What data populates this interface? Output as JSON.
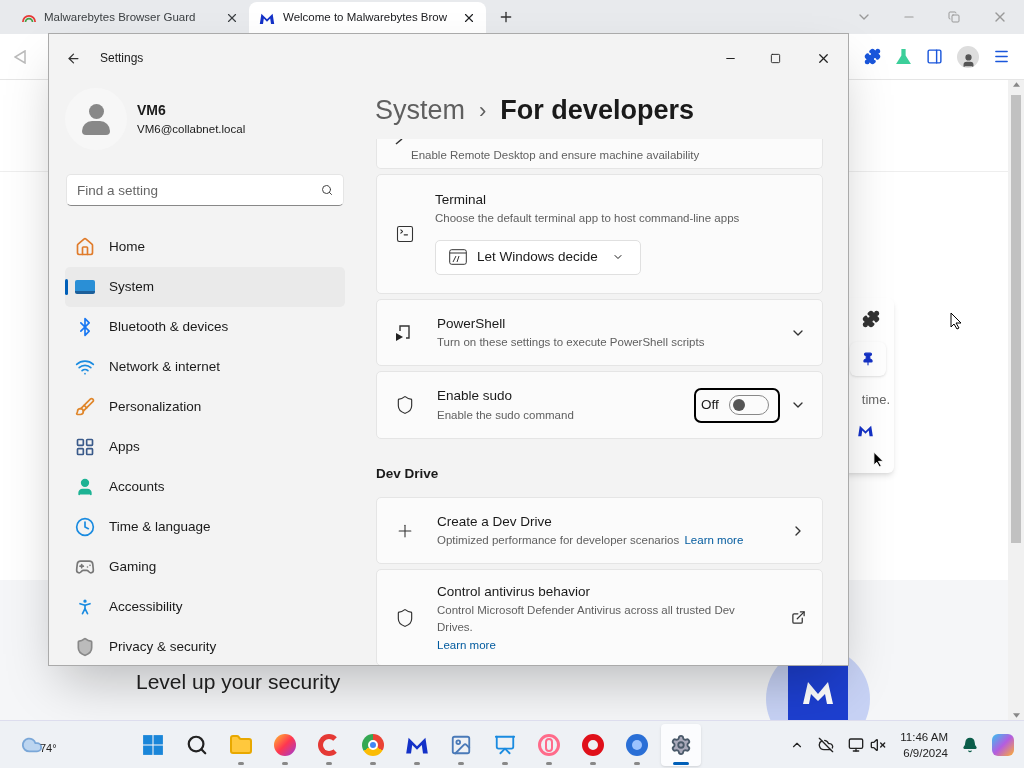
{
  "browser": {
    "tabs": [
      {
        "title": "Malwarebytes Browser Guard",
        "selected": false
      },
      {
        "title": "Welcome to Malwarebytes Brow",
        "selected": true
      }
    ],
    "page": {
      "popup_text": "time.",
      "heading": "Level up your security"
    }
  },
  "settings": {
    "title": "Settings",
    "user": {
      "name": "VM6",
      "email": "VM6@collabnet.local"
    },
    "search": {
      "placeholder": "Find a setting"
    },
    "nav": [
      {
        "label": "Home",
        "selected": false
      },
      {
        "label": "System",
        "selected": true
      },
      {
        "label": "Bluetooth & devices",
        "selected": false
      },
      {
        "label": "Network & internet",
        "selected": false
      },
      {
        "label": "Personalization",
        "selected": false
      },
      {
        "label": "Apps",
        "selected": false
      },
      {
        "label": "Accounts",
        "selected": false
      },
      {
        "label": "Time & language",
        "selected": false
      },
      {
        "label": "Gaming",
        "selected": false
      },
      {
        "label": "Accessibility",
        "selected": false
      },
      {
        "label": "Privacy & security",
        "selected": false
      }
    ],
    "breadcrumb": {
      "parent": "System",
      "separator": "›",
      "current": "For developers"
    },
    "content": [
      {
        "kind": "cut",
        "description": "Enable Remote Desktop and ensure machine availability"
      },
      {
        "kind": "dropdown",
        "title": "Terminal",
        "description": "Choose the default terminal app to host command-line apps",
        "value": "Let Windows decide"
      },
      {
        "kind": "expander",
        "title": "PowerShell",
        "description": "Turn on these settings to execute PowerShell scripts"
      },
      {
        "kind": "toggle",
        "title": "Enable sudo",
        "description": "Enable the sudo command",
        "state_label": "Off",
        "on": false
      },
      {
        "kind": "heading",
        "text": "Dev Drive"
      },
      {
        "kind": "nav",
        "title": "Create a Dev Drive",
        "description": "Optimized performance for developer scenarios",
        "link": "Learn more"
      },
      {
        "kind": "external",
        "title": "Control antivirus behavior",
        "description": "Control Microsoft Defender Antivirus across all trusted Dev Drives.",
        "link": "Learn more"
      }
    ]
  },
  "taskbar": {
    "weather": "74°",
    "apps": [
      {
        "running": true,
        "selected": false
      },
      {
        "running": true,
        "selected": false
      },
      {
        "running": true,
        "selected": false
      },
      {
        "running": true,
        "selected": false
      },
      {
        "running": true,
        "selected": false
      },
      {
        "running": true,
        "selected": false
      },
      {
        "running": true,
        "selected": false
      },
      {
        "running": true,
        "selected": false
      },
      {
        "running": true,
        "selected": false
      },
      {
        "running": true,
        "selected": false
      },
      {
        "running": true,
        "selected": true
      }
    ],
    "time": "11:46 AM",
    "date": "6/9/2024"
  }
}
